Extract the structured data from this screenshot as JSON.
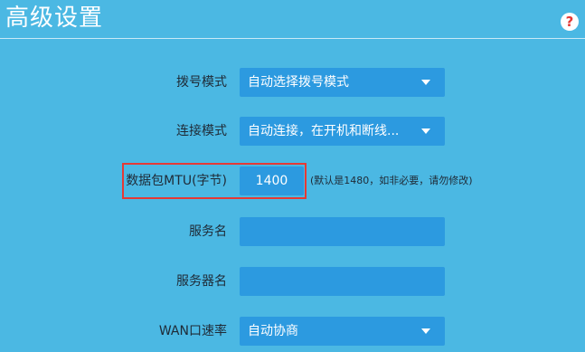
{
  "header": {
    "title": "高级设置",
    "help_icon": "question-mark-icon",
    "help_glyph": "?"
  },
  "form": {
    "dial_mode": {
      "label": "拨号模式",
      "value": "自动选择拨号模式"
    },
    "connect_mode": {
      "label": "连接模式",
      "value": "自动连接，在开机和断线..."
    },
    "mtu": {
      "label": "数据包MTU(字节)",
      "value": "1400",
      "hint": "(默认是1480，如非必要，请勿修改)"
    },
    "service_name": {
      "label": "服务名",
      "value": ""
    },
    "server_name": {
      "label": "服务器名",
      "value": ""
    },
    "wan_speed": {
      "label": "WAN口速率",
      "value": "自动协商"
    }
  },
  "colors": {
    "background": "#4bb8e3",
    "field": "#2c9ae0",
    "highlight": "#e53935",
    "label_text": "#1f2a36"
  }
}
